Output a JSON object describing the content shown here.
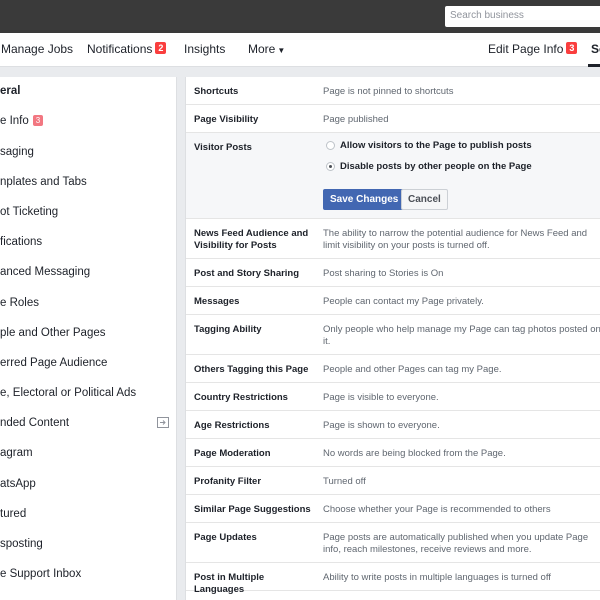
{
  "search": {
    "placeholder": "Search business"
  },
  "nav": {
    "manage_jobs": "Manage Jobs",
    "notifications": "Notifications",
    "notifications_badge": "2",
    "insights": "Insights",
    "more": "More",
    "edit_page_info": "Edit Page Info",
    "edit_page_info_badge": "3",
    "settings_partial": "Se"
  },
  "sidebar": {
    "items": [
      {
        "label": "eral"
      },
      {
        "label": "e Info",
        "badge": "3"
      },
      {
        "label": "saging"
      },
      {
        "label": "nplates and Tabs"
      },
      {
        "label": "ot Ticketing"
      },
      {
        "label": "fications"
      },
      {
        "label": "anced Messaging"
      },
      {
        "label": "e Roles"
      },
      {
        "label": "ple and Other Pages"
      },
      {
        "label": "erred Page Audience"
      },
      {
        "label": "e, Electoral or Political Ads"
      },
      {
        "label": "nded Content"
      },
      {
        "label": "agram"
      },
      {
        "label": "atsApp"
      },
      {
        "label": "tured"
      },
      {
        "label": "sposting"
      },
      {
        "label": "e Support Inbox"
      }
    ]
  },
  "settings": {
    "shortcuts": {
      "label": "Shortcuts",
      "value": "Page is not pinned to shortcuts"
    },
    "visibility": {
      "label": "Page Visibility",
      "value": "Page published"
    },
    "visitor_posts": {
      "label": "Visitor Posts",
      "option_allow": "Allow visitors to the Page to publish posts",
      "option_disable": "Disable posts by other people on the Page",
      "selected": "disable",
      "save": "Save Changes",
      "cancel": "Cancel"
    },
    "news_feed": {
      "label": "News Feed Audience and Visibility for Posts",
      "value": "The ability to narrow the potential audience for News Feed and limit visibility on your posts is turned off."
    },
    "story_sharing": {
      "label": "Post and Story Sharing",
      "value": "Post sharing to Stories is On"
    },
    "messages": {
      "label": "Messages",
      "value": "People can contact my Page privately."
    },
    "tagging": {
      "label": "Tagging Ability",
      "value": "Only people who help manage my Page can tag photos posted on it."
    },
    "others_tagging": {
      "label": "Others Tagging this Page",
      "value": "People and other Pages can tag my Page."
    },
    "country": {
      "label": "Country Restrictions",
      "value": "Page is visible to everyone."
    },
    "age": {
      "label": "Age Restrictions",
      "value": "Page is shown to everyone."
    },
    "moderation": {
      "label": "Page Moderation",
      "value": "No words are being blocked from the Page."
    },
    "profanity": {
      "label": "Profanity Filter",
      "value": "Turned off"
    },
    "similar": {
      "label": "Similar Page Suggestions",
      "value": "Choose whether your Page is recommended to others"
    },
    "updates": {
      "label": "Page Updates",
      "value": "Page posts are automatically published when you update Page info, reach milestones, receive reviews and more."
    },
    "languages": {
      "label": "Post in Multiple Languages",
      "value": "Ability to write posts in multiple languages is turned off"
    }
  }
}
